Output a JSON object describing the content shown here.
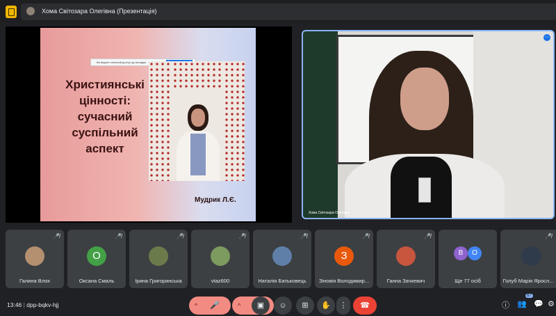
{
  "window": {
    "title": "Хома Світозара Олегівна (Презентація)"
  },
  "slide": {
    "title_lines": [
      "Християнські",
      "цінності:",
      "сучасний",
      "суспільний",
      "аспект"
    ],
    "author": "Мудрик Л.Є.",
    "share_notice": "Ви ведете спільний доступ до вкладки",
    "share_button": "Припинити спільний доступ"
  },
  "speaker": {
    "name": "Хома Світозара Олегівна"
  },
  "participants": [
    {
      "name": "Галина Влох"
    },
    {
      "name": "Оксана Смаль",
      "initial": "О",
      "color": "#43a047"
    },
    {
      "name": "Ірина Григоринська"
    },
    {
      "name": "vtaz600"
    },
    {
      "name": "Наталія Батьковець"
    },
    {
      "name": "Зіновія Володимир...",
      "initial": "З",
      "color": "#e8590c"
    },
    {
      "name": "Ганна Зачкевич"
    },
    {
      "name": "Ще 77 осіб",
      "initials": [
        "В",
        "О"
      ]
    },
    {
      "name": "Голуб Марія Яросл..."
    }
  ],
  "bottombar": {
    "time": "13:46",
    "meeting_code": "dpp-bqkv-hjj",
    "people_count": "87"
  },
  "icons": {
    "mic_off": "🎤̸",
    "mic": "🎤",
    "camera_off": "⊘",
    "captions": "▣",
    "emoji": "☺",
    "present": "⊞",
    "hand": "✋",
    "more": "⋮",
    "end_call": "☎",
    "info": "ⓘ",
    "people": "👥",
    "chat": "💬",
    "activities": "⚙"
  }
}
